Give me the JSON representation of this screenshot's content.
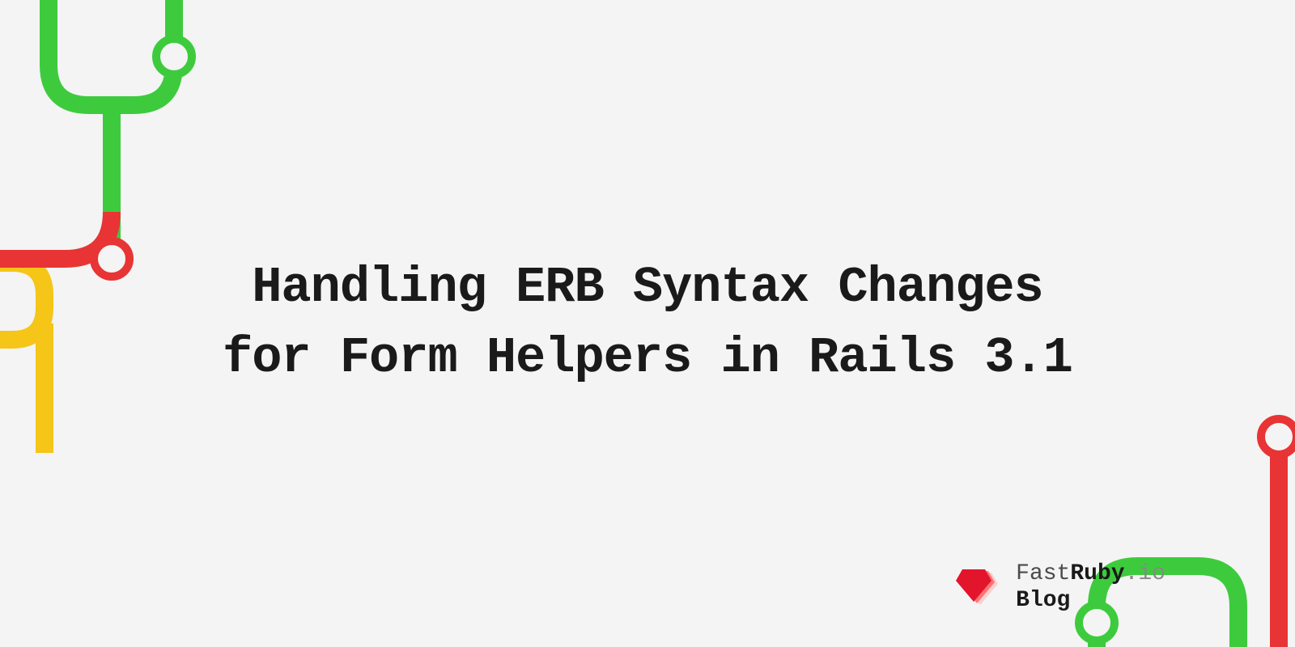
{
  "title": "Handling ERB Syntax Changes for Form Helpers in Rails 3.1",
  "brand": {
    "part1": "Fast",
    "part2": "Ruby",
    "part3": ".io",
    "line2": "Blog"
  },
  "colors": {
    "green": "#3dcb3d",
    "red": "#e83434",
    "yellow": "#f5c518",
    "background": "#f4f4f4"
  }
}
